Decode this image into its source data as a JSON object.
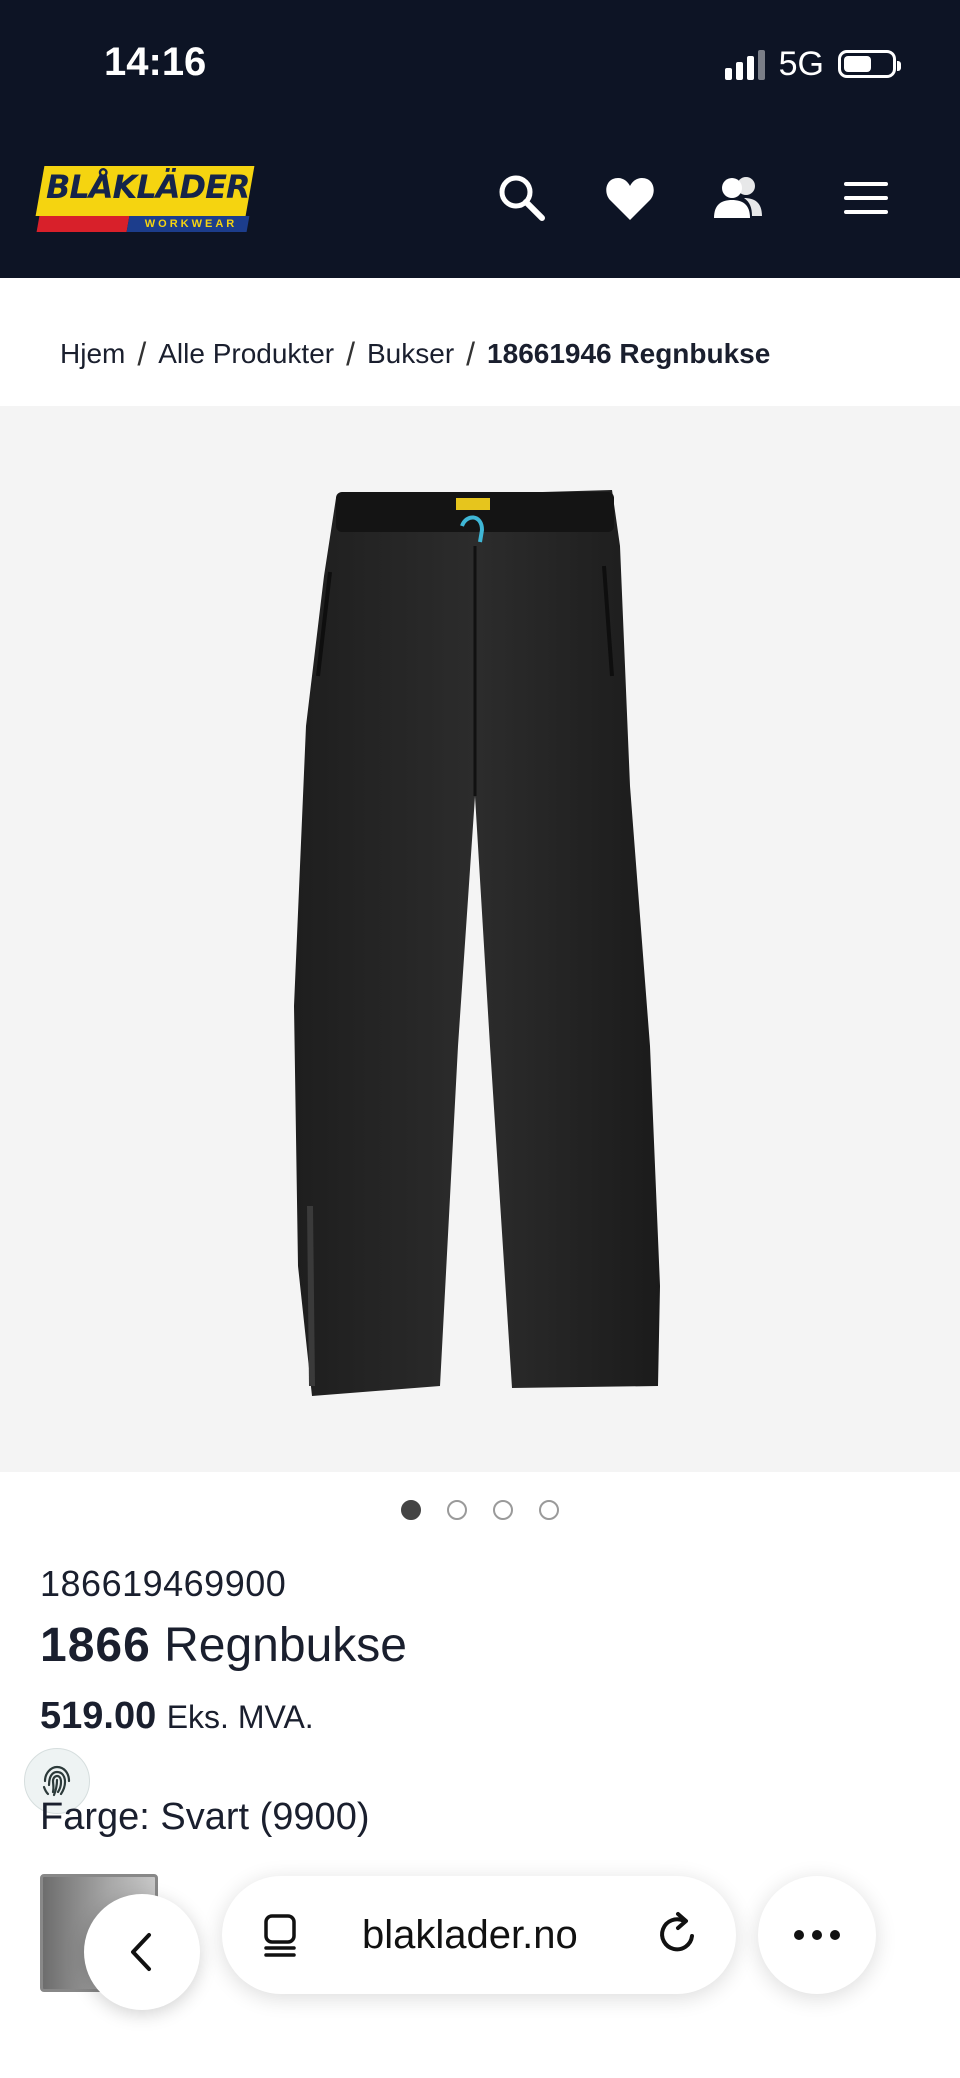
{
  "status_bar": {
    "time": "14:16",
    "network": "5G",
    "battery_level": 0.58
  },
  "header": {
    "logo_text": "BLÅKLÄDER",
    "logo_subtext": "WORKWEAR",
    "icons": [
      "search-icon",
      "heart-icon",
      "account-icon",
      "menu-icon"
    ],
    "background": "#0d1425"
  },
  "breadcrumb": {
    "items": [
      "Hjem",
      "Alle Produkter",
      "Bukser"
    ],
    "current": "18661946 Regnbukse",
    "separator": "/"
  },
  "gallery": {
    "total": 4,
    "active": 1
  },
  "product": {
    "sku": "186619469900",
    "model_number": "1866",
    "name": "Regnbukse",
    "price": "519.00",
    "price_suffix": "Eks. MVA.",
    "color_label": "Farge: Svart (9900)"
  },
  "browser": {
    "url": "blaklader.no"
  },
  "colors": {
    "brand_yellow": "#f5d410",
    "brand_red": "#d8202a",
    "brand_blue": "#1c3d8c"
  }
}
